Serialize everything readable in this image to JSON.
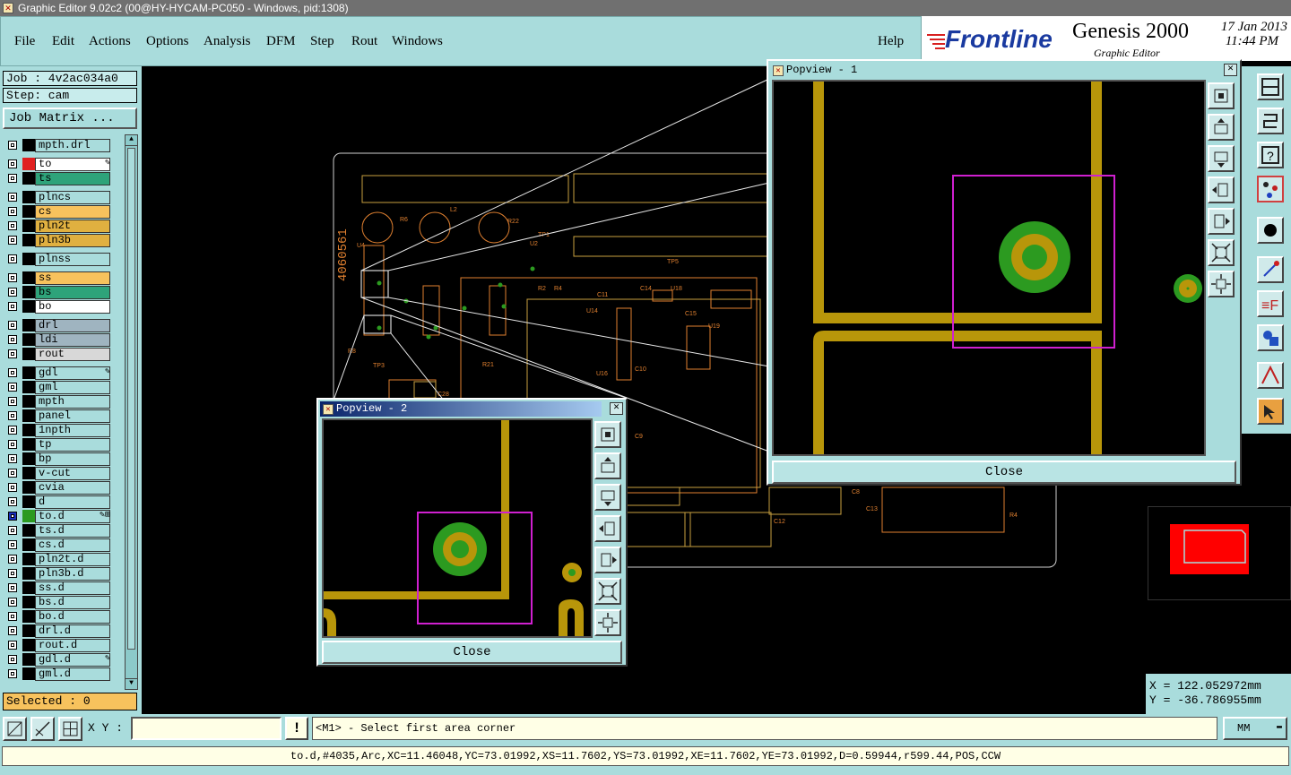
{
  "window": {
    "title": "Graphic Editor 9.02c2 (00@HY-HYCAM-PC050 - Windows, pid:1308)"
  },
  "menu": [
    "File",
    "Edit",
    "Actions",
    "Options",
    "Analysis",
    "DFM",
    "Step",
    "Rout",
    "Windows"
  ],
  "help_label": "Help",
  "brand": {
    "logo": "Frontline",
    "product": "Genesis 2000",
    "subtitle": "Graphic Editor",
    "date": "17 Jan 2013",
    "time": "11:44 PM"
  },
  "job": {
    "job_label": "Job : 4v2ac034a0",
    "step_label": "Step: cam",
    "matrix_button": "Job Matrix ..."
  },
  "layers": [
    {
      "name": "mpth.drl",
      "color": "#a9dcdc",
      "swatch": "#000",
      "mark": ""
    },
    {
      "name": "to",
      "color": "#ffffff",
      "swatch": "#e02020",
      "mark": "✎"
    },
    {
      "name": "ts",
      "color": "#2ea37a",
      "swatch": "#000",
      "mark": ""
    },
    {
      "name": "plncs",
      "color": "#a9dcdc",
      "swatch": "#000",
      "mark": ""
    },
    {
      "name": "cs",
      "color": "#f7c25d",
      "swatch": "#000",
      "mark": ""
    },
    {
      "name": "pln2t",
      "color": "#e0b040",
      "swatch": "#000",
      "mark": ""
    },
    {
      "name": "pln3b",
      "color": "#e0b040",
      "swatch": "#000",
      "mark": ""
    },
    {
      "name": "plnss",
      "color": "#a9dcdc",
      "swatch": "#000",
      "mark": ""
    },
    {
      "name": "ss",
      "color": "#f7c25d",
      "swatch": "#000",
      "mark": ""
    },
    {
      "name": "bs",
      "color": "#2ea37a",
      "swatch": "#000",
      "mark": ""
    },
    {
      "name": "bo",
      "color": "#ffffff",
      "swatch": "#000",
      "mark": ""
    },
    {
      "name": "drl",
      "color": "#9fb4c0",
      "swatch": "#000",
      "mark": ""
    },
    {
      "name": "ldi",
      "color": "#9fb4c0",
      "swatch": "#000",
      "mark": ""
    },
    {
      "name": "rout",
      "color": "#d8d8d8",
      "swatch": "#000",
      "mark": ""
    },
    {
      "name": "gdl",
      "color": "#a9dcdc",
      "swatch": "#000",
      "mark": "✎"
    },
    {
      "name": "gml",
      "color": "#a9dcdc",
      "swatch": "#000",
      "mark": ""
    },
    {
      "name": "mpth",
      "color": "#a9dcdc",
      "swatch": "#000",
      "mark": ""
    },
    {
      "name": "panel",
      "color": "#a9dcdc",
      "swatch": "#000",
      "mark": ""
    },
    {
      "name": "1npth",
      "color": "#a9dcdc",
      "swatch": "#000",
      "mark": ""
    },
    {
      "name": "tp",
      "color": "#a9dcdc",
      "swatch": "#000",
      "mark": ""
    },
    {
      "name": "bp",
      "color": "#a9dcdc",
      "swatch": "#000",
      "mark": ""
    },
    {
      "name": "v-cut",
      "color": "#a9dcdc",
      "swatch": "#000",
      "mark": ""
    },
    {
      "name": "cvia",
      "color": "#a9dcdc",
      "swatch": "#000",
      "mark": ""
    },
    {
      "name": "d",
      "color": "#a9dcdc",
      "swatch": "#000",
      "mark": ""
    },
    {
      "name": "to.d",
      "color": "#a9dcdc",
      "swatch": "#2c9a20",
      "mark": "✎⊞"
    },
    {
      "name": "ts.d",
      "color": "#a9dcdc",
      "swatch": "#000",
      "mark": ""
    },
    {
      "name": "cs.d",
      "color": "#a9dcdc",
      "swatch": "#000",
      "mark": ""
    },
    {
      "name": "pln2t.d",
      "color": "#a9dcdc",
      "swatch": "#000",
      "mark": ""
    },
    {
      "name": "pln3b.d",
      "color": "#a9dcdc",
      "swatch": "#000",
      "mark": ""
    },
    {
      "name": "ss.d",
      "color": "#a9dcdc",
      "swatch": "#000",
      "mark": ""
    },
    {
      "name": "bs.d",
      "color": "#a9dcdc",
      "swatch": "#000",
      "mark": ""
    },
    {
      "name": "bo.d",
      "color": "#a9dcdc",
      "swatch": "#000",
      "mark": ""
    },
    {
      "name": "drl.d",
      "color": "#a9dcdc",
      "swatch": "#000",
      "mark": ""
    },
    {
      "name": "rout.d",
      "color": "#a9dcdc",
      "swatch": "#000",
      "mark": ""
    },
    {
      "name": "gdl.d",
      "color": "#a9dcdc",
      "swatch": "#000",
      "mark": "✎"
    },
    {
      "name": "gml.d",
      "color": "#a9dcdc",
      "swatch": "#000",
      "mark": ""
    }
  ],
  "selected_label": "Selected : 0",
  "coords": {
    "x": "X = 122.052972mm",
    "y": "Y = -36.786955mm"
  },
  "xy_label": "X Y :",
  "xy_value": "",
  "prompt": "<M1> - Select first area corner",
  "units": "MM",
  "status": "to.d,#4035,Arc,XC=11.46048,YC=73.01992,XS=11.7602,YS=73.01992,XE=11.7602,YE=73.01992,D=0.59944,r599.44,POS,CCW",
  "popview1": {
    "title": "Popview - 1",
    "close": "Close"
  },
  "popview2": {
    "title": "Popview - 2",
    "close": "Close"
  },
  "colors": {
    "panel": "#a9dcdc",
    "trace": "#b8960a",
    "pad": "#2c9a20",
    "highlight": "#d020d0",
    "outline": "#e08030"
  }
}
